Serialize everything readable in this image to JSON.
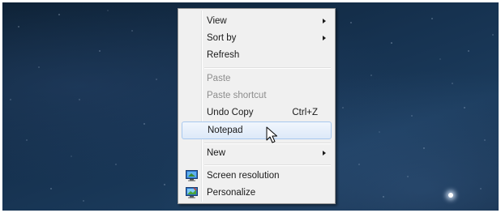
{
  "context_menu": {
    "items": [
      {
        "label": "View",
        "submenu": true,
        "enabled": true
      },
      {
        "label": "Sort by",
        "submenu": true,
        "enabled": true
      },
      {
        "label": "Refresh",
        "submenu": false,
        "enabled": true
      },
      {
        "label": "Paste",
        "submenu": false,
        "enabled": false
      },
      {
        "label": "Paste shortcut",
        "submenu": false,
        "enabled": false
      },
      {
        "label": "Undo Copy",
        "shortcut": "Ctrl+Z",
        "submenu": false,
        "enabled": true
      },
      {
        "label": "Notepad",
        "submenu": false,
        "enabled": true,
        "highlighted": true
      },
      {
        "label": "New",
        "submenu": true,
        "enabled": true
      },
      {
        "label": "Screen resolution",
        "icon": "screen-resolution-icon",
        "submenu": false,
        "enabled": true
      },
      {
        "label": "Personalize",
        "icon": "personalize-icon",
        "submenu": false,
        "enabled": true
      }
    ]
  },
  "colors": {
    "menu_background": "#f0f0f0",
    "highlight_border": "#a8c8ee",
    "disabled_text": "#8d8d8d",
    "desktop_background": "#163250"
  },
  "cursor": {
    "icon": "mouse-pointer-icon"
  }
}
